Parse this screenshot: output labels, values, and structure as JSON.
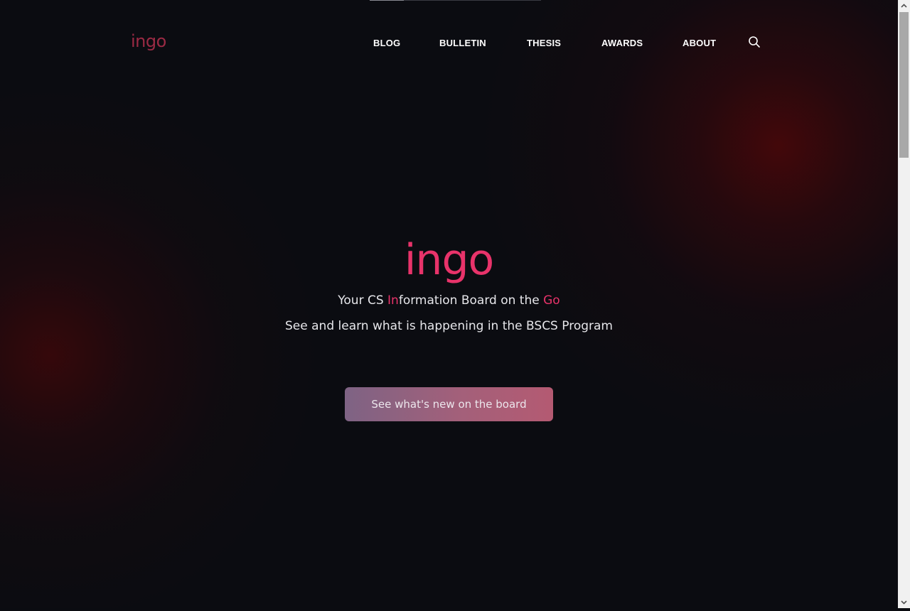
{
  "header": {
    "brand": "ingo",
    "nav": {
      "blog": "BLOG",
      "bulletin": "BULLETIN",
      "thesis": "THESIS",
      "awards": "AWARDS",
      "about": "ABOUT"
    },
    "search_icon": "search-icon"
  },
  "hero": {
    "title": "ingo",
    "tagline": {
      "part1": "Your CS ",
      "hl1": "In",
      "part2": "formation Board on the ",
      "hl2": "Go"
    },
    "subline": "See and learn what is happening in the BSCS Program",
    "cta_label": "See what's new on the board"
  },
  "colors": {
    "background": "#0b0c11",
    "accent": "#e8336a",
    "brand_small": "#9b2a44",
    "glow": "#46080a"
  },
  "scrollbar": {
    "up_icon": "chevron-up-icon",
    "down_icon": "chevron-down-icon"
  }
}
